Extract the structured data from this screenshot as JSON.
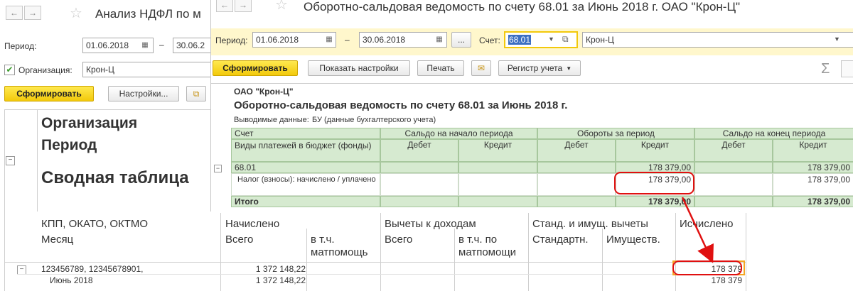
{
  "ndfl_window": {
    "title": "Анализ НДФЛ по м",
    "period_label": "Период:",
    "date_from": "01.06.2018",
    "dash": "–",
    "date_to": "30.06.2",
    "org_label": "Организация:",
    "org_value": "Крон-Ц",
    "generate_btn": "Сформировать",
    "settings_btn": "Настройки...",
    "report": {
      "org_caption": "Организация",
      "period_caption": "Период",
      "table_title": "Сводная таблица",
      "headers": {
        "kpp": "КПП, ОКАТО, ОКТМО",
        "month": "Месяц",
        "accrued": "Начислено",
        "accrued_total": "Всего",
        "accrued_matpom": "в т.ч. матпомощь",
        "deductions": "Вычеты к доходам",
        "ded_total": "Всего",
        "ded_matpom": "в т.ч. по матпомощи",
        "std_prop": "Станд. и имущ. вычеты",
        "std": "Стандартн.",
        "prop": "Имуществ.",
        "calculated": "Исчислено"
      },
      "rows": [
        {
          "label": "123456789, 12345678901,",
          "total": "1 372 148,22",
          "calculated": "178 379"
        },
        {
          "label": "Июнь 2018",
          "total": "1 372 148,22",
          "calculated": "178 379"
        }
      ]
    }
  },
  "osv_window": {
    "title": "Оборотно-сальдовая ведомость по счету 68.01 за Июнь 2018 г. ОАО \"Крон-Ц\"",
    "period_label": "Период:",
    "date_from": "01.06.2018",
    "dash": "–",
    "date_to": "30.06.2018",
    "dots_btn": "...",
    "account_label": "Счет:",
    "account_value": "68.01",
    "org_value": "Крон-Ц",
    "generate_btn": "Сформировать",
    "show_settings_btn": "Показать настройки",
    "print_btn": "Печать",
    "register_btn": "Регистр учета",
    "sigma": "Σ",
    "report": {
      "org": "ОАО \"Крон-Ц\"",
      "title": "Оборотно-сальдовая ведомость по счету 68.01 за Июнь 2018 г.",
      "output_label": "Выводимые данные:",
      "output_value": "БУ (данные бухгалтерского учета)",
      "headers": {
        "account": "Счет",
        "payment_types": "Виды платежей в бюджет (фонды)",
        "opening": "Сальдо на начало периода",
        "turnover": "Обороты за период",
        "closing": "Сальдо на конец периода",
        "debit": "Дебет",
        "credit": "Кредит"
      },
      "rows": [
        {
          "label": "68.01",
          "turnover_credit": "178 379,00",
          "closing_credit": "178 379,00"
        },
        {
          "label": "Налог (взносы): начислено / уплачено",
          "turnover_credit": "178 379,00",
          "closing_credit": "178 379,00"
        },
        {
          "label": "Итого",
          "turnover_credit": "178 379,00",
          "closing_credit": "178 379,00"
        }
      ]
    }
  },
  "colors": {
    "accent_yellow": "#f2c90b",
    "header_green": "#d6ead0",
    "highlight_red": "#e01010",
    "settings_bg": "#fff7cc"
  }
}
